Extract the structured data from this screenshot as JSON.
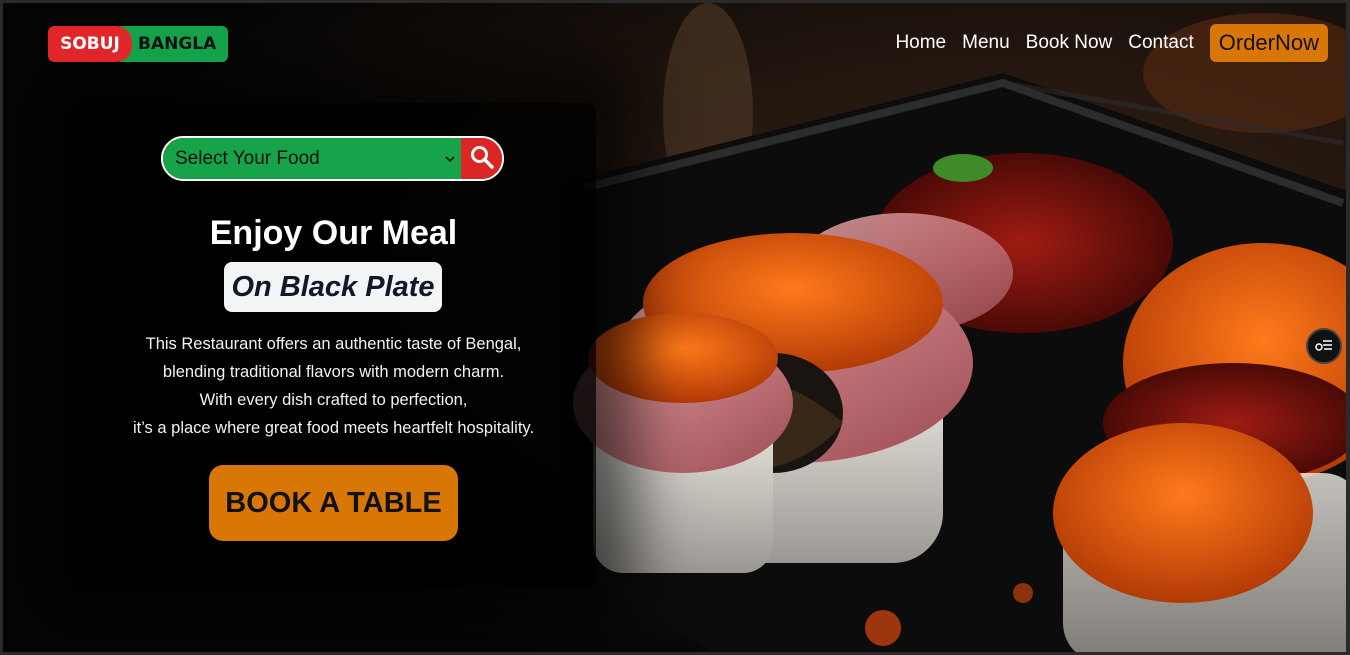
{
  "brand": {
    "left": "SOBUJ",
    "right": "BANGLA",
    "red": "#e02628",
    "green": "#13a24a"
  },
  "nav": {
    "items": [
      {
        "label": "Home"
      },
      {
        "label": "Menu"
      },
      {
        "label": "Book Now"
      },
      {
        "label": "Contact"
      }
    ],
    "order_label": "OrderNow",
    "accent": "#d97706"
  },
  "search": {
    "selected": "Select Your Food",
    "icon": "search-icon"
  },
  "hero": {
    "headline": "Enjoy Our Meal",
    "tagline": "On Black Plate",
    "description": [
      "This Restaurant offers an authentic taste of Bengal,",
      "blending traditional flavors with modern charm.",
      "With every dish crafted to perfection,",
      "it’s a place where great food meets heartfelt hospitality."
    ],
    "cta": "BOOK A TABLE"
  },
  "floating_widget": {
    "icon": "settings-toggle-icon"
  }
}
